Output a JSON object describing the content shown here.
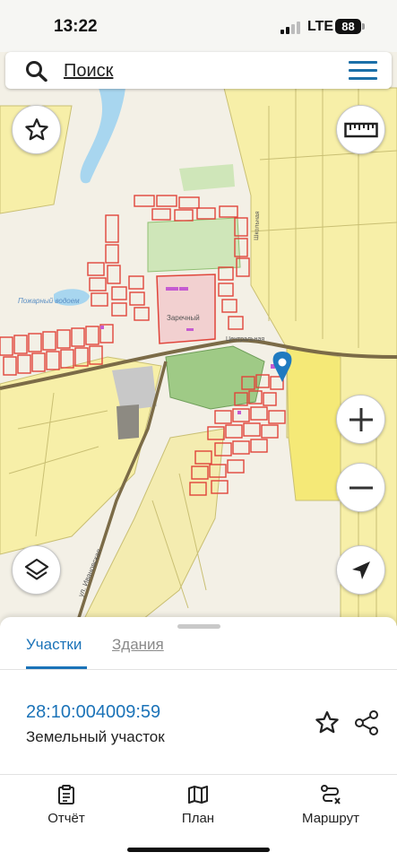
{
  "status_bar": {
    "time": "13:22",
    "network": "LTE",
    "battery": "88"
  },
  "search": {
    "placeholder": "Поиск",
    "icon": "search-icon",
    "menu_icon": "menu-icon"
  },
  "map": {
    "labels": {
      "settlement": "Заречный",
      "lake": "Пожарный водоем",
      "street_west": "Центральная",
      "street_north": "Школьная",
      "road_diag": "ул. Ивановская"
    },
    "controls": {
      "favorite": "star-icon",
      "ruler": "ruler-icon",
      "zoom_in": "plus-icon",
      "zoom_out": "minus-icon",
      "layers": "layers-icon",
      "locate": "navigation-arrow-icon"
    },
    "marker_color": "#1f7ac0",
    "parcel_color": "#e0443a",
    "yellow_fill": "#f7efa8",
    "green_fill": "#cfe6b9"
  },
  "sheet": {
    "tabs": [
      {
        "label": "Участки",
        "active": true
      },
      {
        "label": "Здания",
        "active": false
      }
    ],
    "parcel": {
      "number": "28:10:004009:59",
      "type": "Земельный участок"
    }
  },
  "bottom_nav": [
    {
      "label": "Отчёт",
      "icon": "report-icon"
    },
    {
      "label": "План",
      "icon": "map-plan-icon"
    },
    {
      "label": "Маршрут",
      "icon": "route-icon"
    }
  ],
  "accent_color": "#1b73b8"
}
